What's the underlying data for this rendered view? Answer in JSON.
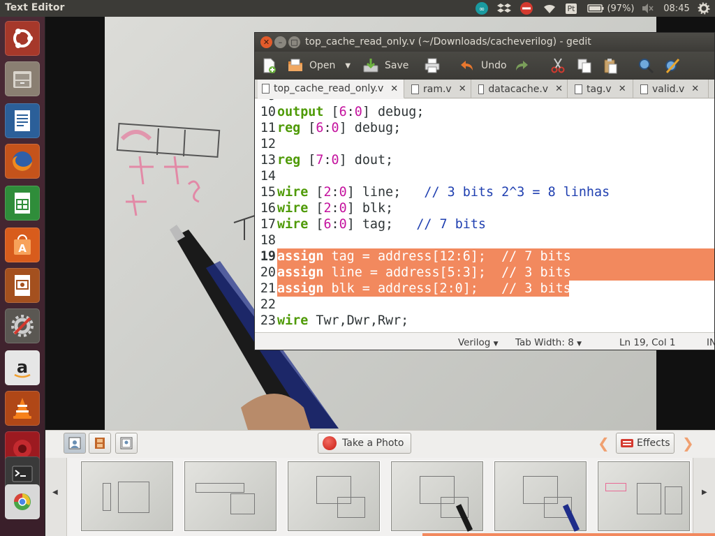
{
  "top_panel": {
    "app_title": "Text Editor",
    "battery": "(97%)",
    "time": "08:45",
    "tray_icons": [
      "arduino-icon",
      "dropbox-icon",
      "stop-icon",
      "wifi-icon",
      "keyboard-layout-icon",
      "battery-icon",
      "volume-muted-icon",
      "settings-gear-icon"
    ],
    "keyboard_layout": "Pt"
  },
  "launcher": {
    "items": [
      "ubuntu-dash-icon",
      "files-icon",
      "writer-icon",
      "firefox-icon",
      "calc-icon",
      "software-center-icon",
      "impress-icon",
      "system-settings-icon",
      "amazon-icon",
      "vlc-icon",
      "cheese-icon",
      "terminal-icon"
    ]
  },
  "gedit": {
    "title": "top_cache_read_only.v (~/Downloads/cacheverilog) - gedit",
    "toolbar": {
      "open_label": "Open",
      "save_label": "Save",
      "undo_label": "Undo"
    },
    "tabs": [
      {
        "label": "top_cache_read_only.v",
        "active": true
      },
      {
        "label": "ram.v",
        "active": false
      },
      {
        "label": "datacache.v",
        "active": false
      },
      {
        "label": "tag.v",
        "active": false
      },
      {
        "label": "valid.v",
        "active": false
      }
    ],
    "code_lines": [
      {
        "n": "10",
        "code": "output [6:0] debug;"
      },
      {
        "n": "11",
        "code": "reg [6:0] debug;"
      },
      {
        "n": "12",
        "code": ""
      },
      {
        "n": "13",
        "code": "reg [7:0] dout;"
      },
      {
        "n": "14",
        "code": ""
      },
      {
        "n": "15",
        "code": "wire [2:0] line;   // 3 bits 2^3 = 8 linhas"
      },
      {
        "n": "16",
        "code": "wire [2:0] blk;"
      },
      {
        "n": "17",
        "code": "wire [6:0] tag;   // 7 bits"
      },
      {
        "n": "18",
        "code": ""
      },
      {
        "n": "19",
        "code": "assign tag = address[12:6];  // 7 bits"
      },
      {
        "n": "20",
        "code": "assign line = address[5:3];  // 3 bits"
      },
      {
        "n": "21",
        "code": "assign blk = address[2:0];   // 3 bits"
      },
      {
        "n": "22",
        "code": ""
      },
      {
        "n": "23",
        "code": "wire Twr,Dwr,Rwr;"
      }
    ],
    "status": {
      "language": "Verilog",
      "tab_width": "Tab Width: 8",
      "position": "Ln 19, Col 1",
      "mode": "IN"
    }
  },
  "cheese": {
    "take_photo_label": "Take a Photo",
    "effects_label": "Effects",
    "thumbnail_count": 6
  }
}
